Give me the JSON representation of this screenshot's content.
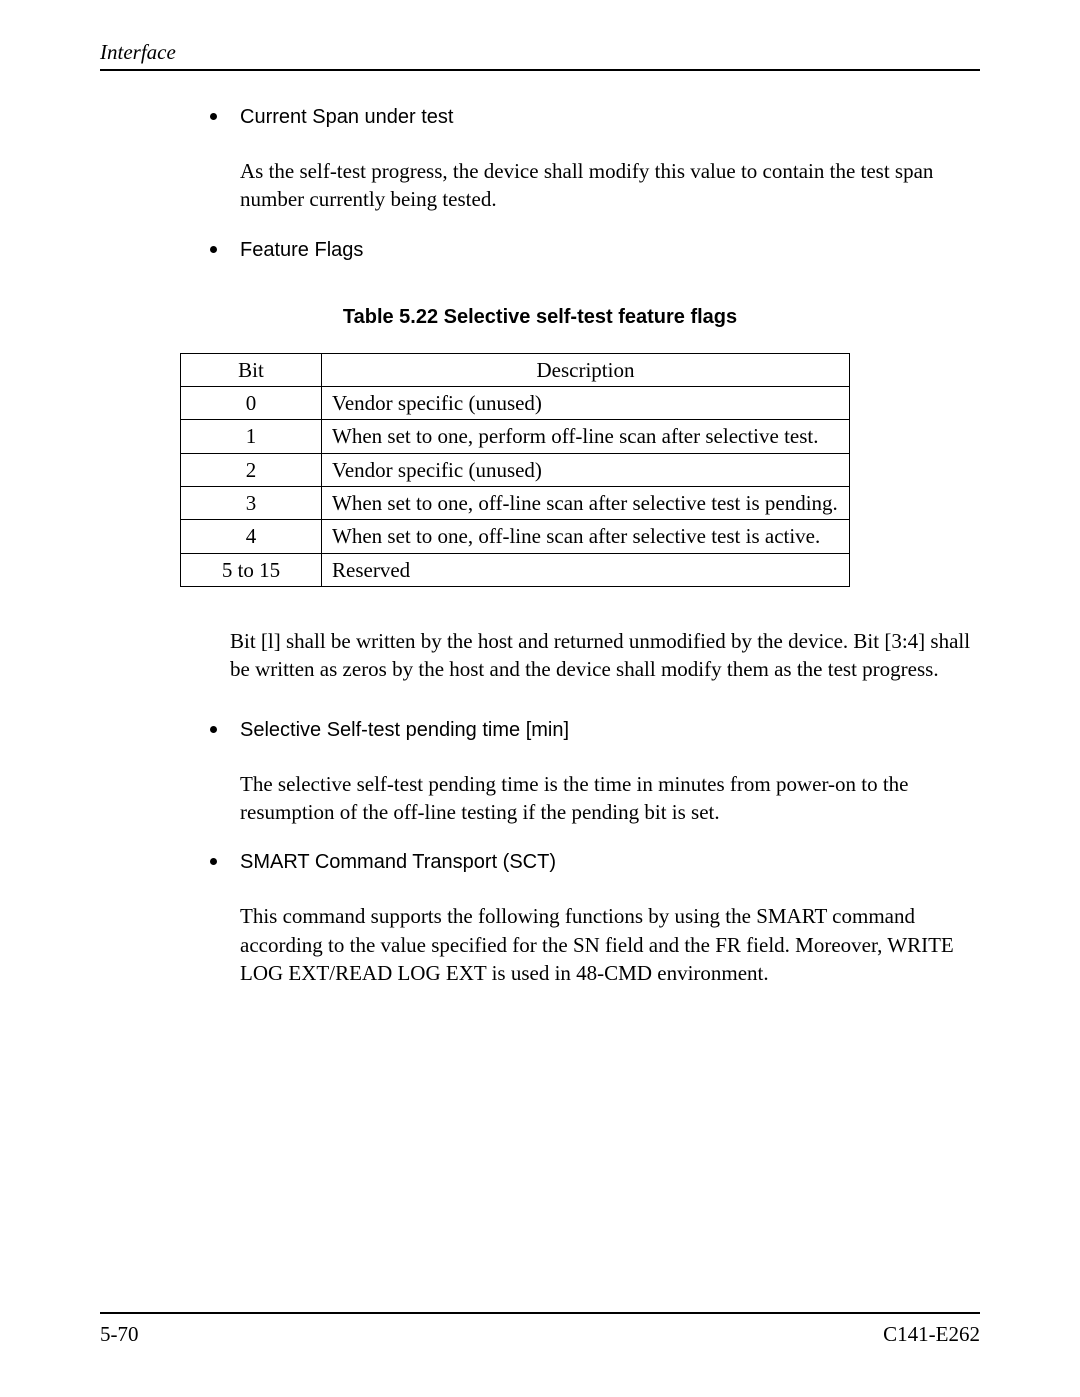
{
  "header": {
    "title": "Interface"
  },
  "items": [
    {
      "title": "Current Span under test",
      "body": "As the self-test progress, the device shall modify this value to contain the test span number currently being tested."
    },
    {
      "title": "Feature Flags"
    }
  ],
  "table": {
    "caption": "Table 5.22  Selective self-test feature flags",
    "headers": {
      "bit": "Bit",
      "desc": "Description"
    },
    "rows": [
      {
        "bit": "0",
        "desc": "Vendor specific (unused)"
      },
      {
        "bit": "1",
        "desc": "When set to one, perform off-line scan after selective test."
      },
      {
        "bit": "2",
        "desc": "Vendor specific (unused)"
      },
      {
        "bit": "3",
        "desc": "When set to one, off-line scan after selective test is pending."
      },
      {
        "bit": "4",
        "desc": "When set to one, off-line scan after selective test is active."
      },
      {
        "bit": "5 to 15",
        "desc": "Reserved"
      }
    ]
  },
  "post_table_paragraph": "Bit [l] shall be written by the host and returned unmodified by the device. Bit [3:4] shall be written as zeros by the host and the device shall modify them as the test progress.",
  "items2": [
    {
      "title": "Selective Self-test pending time [min]",
      "body": "The selective self-test pending time is the time in minutes from power-on to the resumption of the off-line testing if the pending bit is set."
    },
    {
      "title": "SMART Command Transport (SCT)",
      "body": "This command supports the following functions by using the SMART command according to the value specified for the SN field and the FR field.  Moreover, WRITE LOG EXT/READ LOG EXT is used in 48-CMD environment."
    }
  ],
  "footer": {
    "left": "5-70",
    "right": "C141-E262"
  }
}
